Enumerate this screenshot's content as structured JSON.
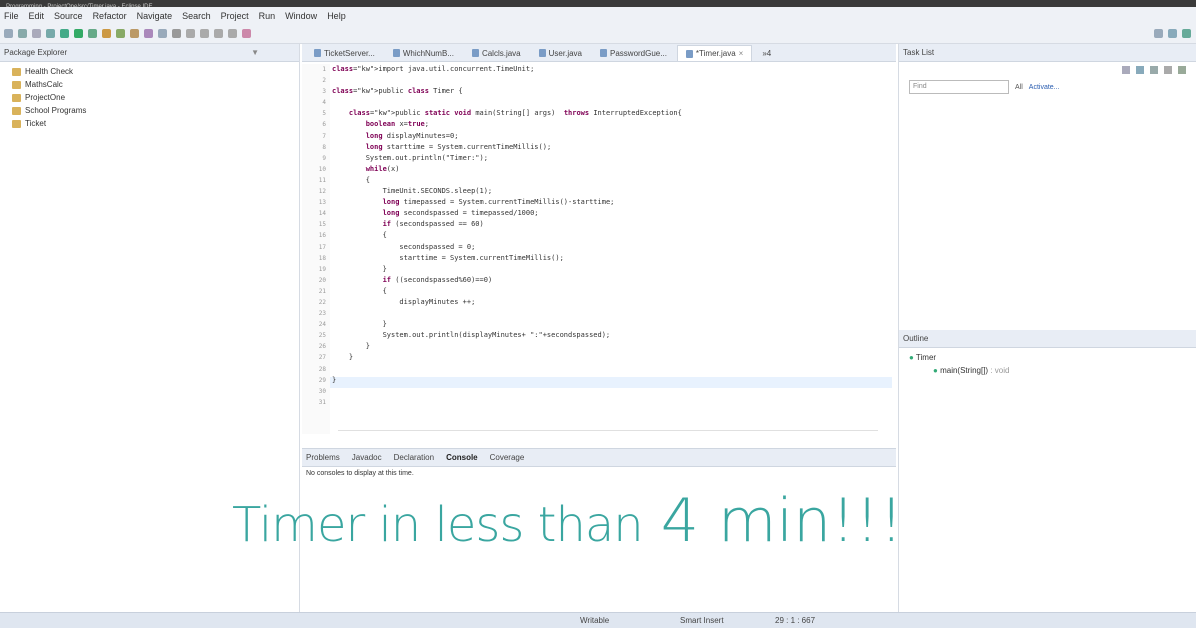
{
  "window": {
    "title": "Programming - ProjectOne/src/Timer.java - Eclipse IDE"
  },
  "menu": [
    "File",
    "Edit",
    "Source",
    "Refactor",
    "Navigate",
    "Search",
    "Project",
    "Run",
    "Window",
    "Help"
  ],
  "package_explorer": {
    "title": "Package Explorer",
    "projects": [
      "Health Check",
      "MathsCalc",
      "ProjectOne",
      "School Programs",
      "Ticket"
    ]
  },
  "editor": {
    "tabs": [
      "TicketServer...",
      "WhichNumB...",
      "Calcls.java",
      "User.java",
      "PasswordGue...",
      "*Timer.java"
    ],
    "overflow": "»4",
    "line_numbers": [
      "1",
      "2",
      "3",
      "4",
      "5",
      "6",
      "7",
      "8",
      "9",
      "10",
      "11",
      "12",
      "13",
      "14",
      "15",
      "16",
      "17",
      "18",
      "19",
      "20",
      "21",
      "22",
      "23",
      "24",
      "25",
      "26",
      "27",
      "28",
      "29",
      "30",
      "31"
    ],
    "code": [
      "import java.util.concurrent.TimeUnit;",
      "",
      "public class Timer {",
      "",
      "    public static void main(String[] args)  throws InterruptedException{",
      "        boolean x=true;",
      "        long displayMinutes=0;",
      "        long starttime = System.currentTimeMillis();",
      "        System.out.println(\"Timer:\");",
      "        while(x)",
      "        {",
      "            TimeUnit.SECONDS.sleep(1);",
      "            long timepassed = System.currentTimeMillis()-starttime;",
      "            long secondspassed = timepassed/1000;",
      "            if (secondspassed == 60)",
      "            {",
      "                secondspassed = 0;",
      "                starttime = System.currentTimeMillis();",
      "            }",
      "            if ((secondspassed%60)==0)",
      "            {",
      "                displayMinutes ++;",
      "",
      "            }",
      "            System.out.println(displayMinutes+ \":\"+secondspassed);",
      "        }",
      "    }",
      "",
      "}",
      "",
      ""
    ]
  },
  "task_list": {
    "title": "Task List",
    "find_placeholder": "Find",
    "all_label": "All",
    "activate_label": "Activate..."
  },
  "outline": {
    "title": "Outline",
    "class_name": "Timer",
    "method": "main(String[])",
    "method_type": ": void"
  },
  "console": {
    "tabs": [
      "Problems",
      "Javadoc",
      "Declaration",
      "Console",
      "Coverage"
    ],
    "message": "No consoles to display at this time."
  },
  "status": {
    "writable": "Writable",
    "insert_mode": "Smart Insert",
    "position": "29 : 1 : 667"
  },
  "overlay": {
    "text1": "Timer in less than",
    "text2": "4 min!!!"
  },
  "colors": {
    "overlay": "#3aa6a0",
    "keyword": "#7f0055"
  }
}
